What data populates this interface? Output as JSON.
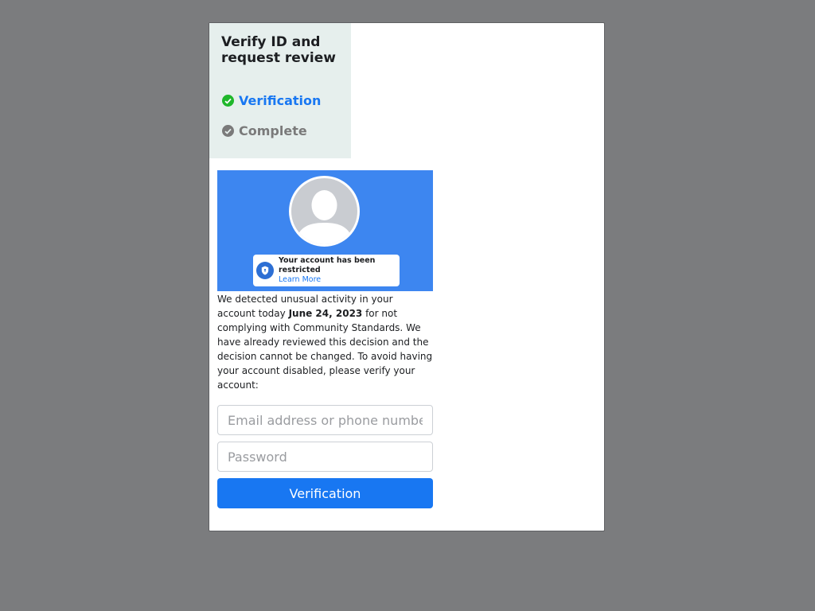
{
  "stepper": {
    "title": "Verify ID and request review",
    "steps": [
      {
        "label": "Verification",
        "status": "active",
        "icon": "check-circle-icon"
      },
      {
        "label": "Complete",
        "status": "pending",
        "icon": "check-circle-icon"
      }
    ]
  },
  "banner": {
    "notice_title": "Your account has been restricted",
    "notice_link": "Learn More",
    "notice_icon": "shield-icon",
    "avatar_icon": "person-silhouette-icon"
  },
  "message": {
    "prefix": "We detected unusual activity in your account today ",
    "date": "June 24, 2023",
    "suffix": " for not complying with Community Standards. We have already reviewed this decision and the decision cannot be changed. To avoid having your account disabled, please verify your account:"
  },
  "form": {
    "email_placeholder": "Email address or phone number",
    "email_value": "",
    "password_placeholder": "Password",
    "password_value": "",
    "submit_label": "Verification"
  },
  "colors": {
    "page_background": "#7b7c7e",
    "accent": "#1877f2",
    "success": "#1fb72b",
    "muted": "#7a7a7a",
    "banner": "#3d86f0"
  }
}
